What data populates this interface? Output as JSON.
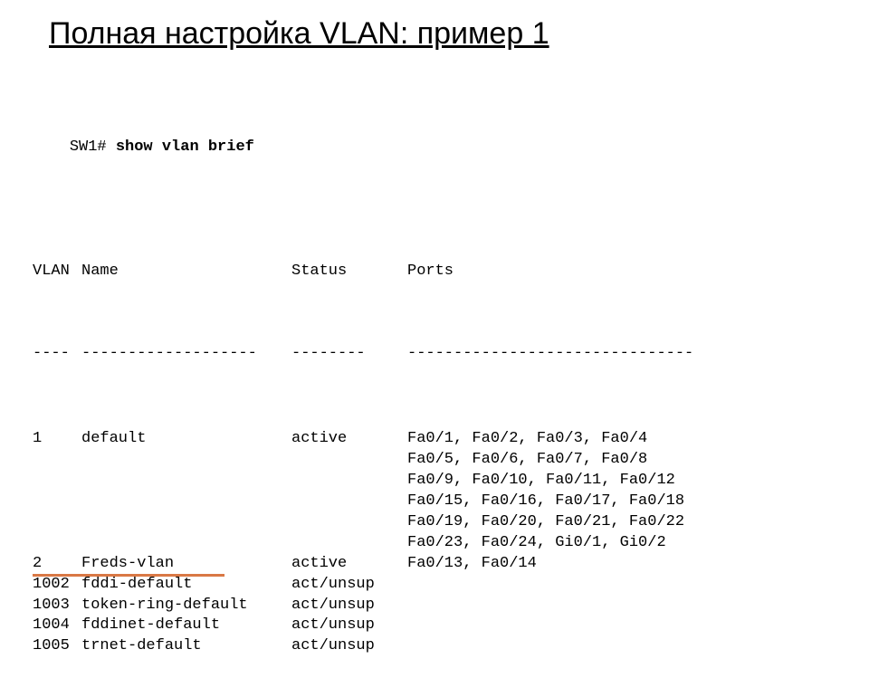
{
  "title": "Полная настройка VLAN: пример 1",
  "prompt": "SW1# ",
  "command": "show vlan brief",
  "headers": {
    "vlan": "VLAN",
    "name": "Name",
    "status": "Status",
    "ports": "Ports"
  },
  "divider": {
    "vlan": "----",
    "name": "-------------------",
    "status": "--------",
    "ports": "-------------------------------"
  },
  "rows": [
    {
      "vlan": "1",
      "name": "default",
      "status": "active",
      "ports": [
        "Fa0/1, Fa0/2, Fa0/3, Fa0/4",
        "Fa0/5, Fa0/6, Fa0/7, Fa0/8",
        "Fa0/9, Fa0/10, Fa0/11, Fa0/12",
        "Fa0/15, Fa0/16, Fa0/17, Fa0/18",
        "Fa0/19, Fa0/20, Fa0/21, Fa0/22",
        "Fa0/23, Fa0/24, Gi0/1, Gi0/2"
      ],
      "highlight": false
    },
    {
      "vlan": "2",
      "name": "Freds-vlan",
      "status": "active",
      "ports": [
        "Fa0/13, Fa0/14"
      ],
      "highlight": true
    },
    {
      "vlan": "1002",
      "name": "fddi-default",
      "status": "act/unsup",
      "ports": [],
      "highlight": false
    },
    {
      "vlan": "1003",
      "name": "token-ring-default",
      "status": "act/unsup",
      "ports": [],
      "highlight": false
    },
    {
      "vlan": "1004",
      "name": "fddinet-default",
      "status": "act/unsup",
      "ports": [],
      "highlight": false
    },
    {
      "vlan": "1005",
      "name": "trnet-default",
      "status": "act/unsup",
      "ports": [],
      "highlight": false
    }
  ]
}
